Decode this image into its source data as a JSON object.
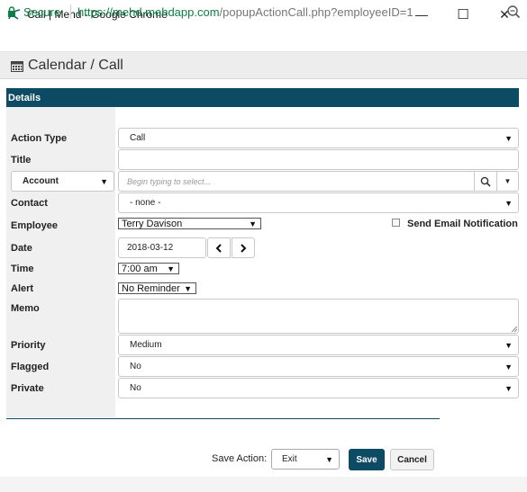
{
  "window": {
    "title": "Call | Mehd - Google Chrome",
    "minimize_glyph": "—",
    "maximize_glyph": "☐",
    "close_glyph": "✕"
  },
  "address": {
    "secure_label": "Secure",
    "url_scheme": "https://",
    "url_domain": "mehd.mehdapp.com",
    "url_path": "/popupActionCall.php?employeeID=1"
  },
  "header": {
    "title": "Calendar / Call"
  },
  "details": {
    "title": "Details"
  },
  "form": {
    "action_type": {
      "label": "Action Type",
      "value": "Call"
    },
    "title": {
      "label": "Title",
      "value": ""
    },
    "account": {
      "selector_value": "Account",
      "placeholder": "Begin typing to select..."
    },
    "contact": {
      "label": "Contact",
      "value": "- none -"
    },
    "employee": {
      "label": "Employee",
      "value": "Terry Davison"
    },
    "email_notification": {
      "label": "Send Email Notification",
      "checked": false
    },
    "date": {
      "label": "Date",
      "value": "2018-03-12"
    },
    "time": {
      "label": "Time",
      "value": "7:00 am"
    },
    "alert": {
      "label": "Alert",
      "value": "No Reminder"
    },
    "memo": {
      "label": "Memo",
      "value": ""
    },
    "priority": {
      "label": "Priority",
      "value": "Medium"
    },
    "flagged": {
      "label": "Flagged",
      "value": "No"
    },
    "private": {
      "label": "Private",
      "value": "No"
    }
  },
  "footer": {
    "save_action_label": "Save Action:",
    "save_action_value": "Exit",
    "save_button": "Save",
    "cancel_button": "Cancel"
  },
  "colors": {
    "brand": "#0d4a63",
    "secure_green": "#0b8043",
    "url_gray": "#767676"
  },
  "icons": [
    "chrome-app-icon",
    "lock-icon",
    "zoom-icon",
    "calendar-icon",
    "search-icon",
    "caret-down-icon",
    "chevron-left-icon",
    "chevron-right-icon",
    "resize-grip-icon"
  ]
}
